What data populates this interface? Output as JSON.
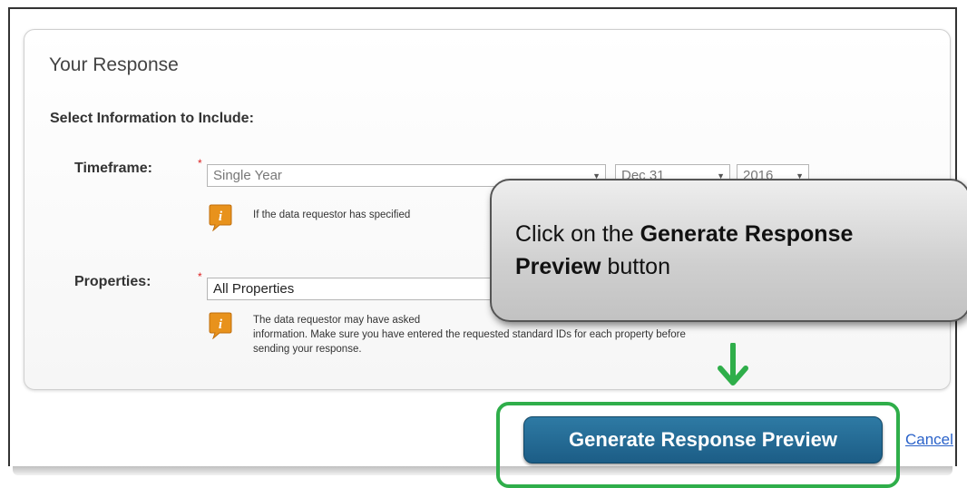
{
  "panel": {
    "title": "Your Response",
    "section_title": "Select Information to Include:"
  },
  "timeframe": {
    "label": "Timeframe:",
    "required_mark": "*",
    "period_value": "Single Year",
    "month_value": "Dec 31",
    "year_value": "2016",
    "info_text": "If the data requestor has specified"
  },
  "properties": {
    "label": "Properties:",
    "required_mark": "*",
    "value": "All Properties",
    "info_lines": [
      "The data requestor may have asked",
      "information. Make sure you have entered the requested standard IDs for each property before",
      "sending your response."
    ]
  },
  "callout": {
    "text_plain_1": "Click on the ",
    "text_bold_1": "Generate Response",
    "text_bold_2": "Preview",
    "text_plain_2": " button"
  },
  "actions": {
    "generate_label": "Generate Response Preview",
    "cancel_label": "Cancel"
  },
  "colors": {
    "button": "#1f6290",
    "highlight": "#2fae4a",
    "arrow": "#2fae4a",
    "info_icon": "#e8921c"
  },
  "icons": {
    "info": "info-icon",
    "arrow": "arrow-down-icon",
    "caret": "chevron-down-icon"
  }
}
